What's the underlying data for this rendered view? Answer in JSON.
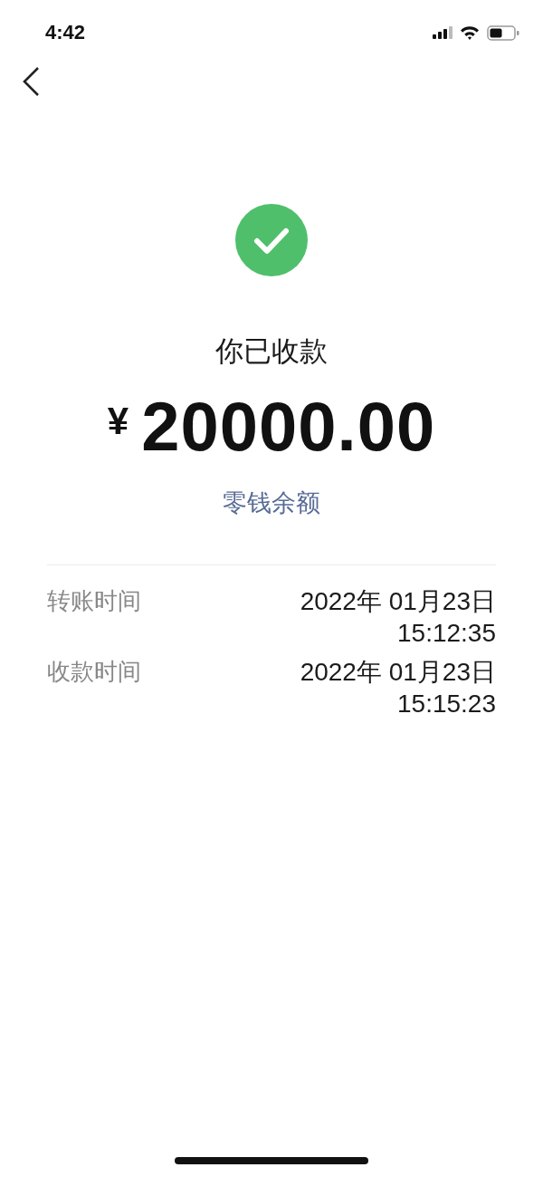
{
  "status_bar": {
    "time": "4:42"
  },
  "result": {
    "title": "你已收款",
    "currency": "¥",
    "amount": "20000.00",
    "link": "零钱余额"
  },
  "details": [
    {
      "label": "转账时间",
      "value": "2022年 01月23日 15:12:35"
    },
    {
      "label": "收款时间",
      "value": "2022年 01月23日 15:15:23"
    }
  ]
}
